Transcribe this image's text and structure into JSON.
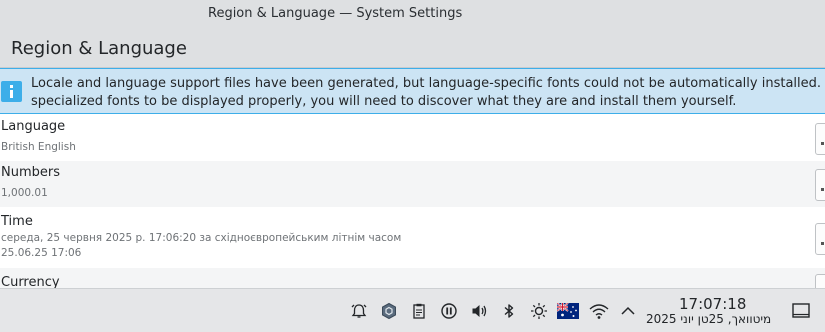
{
  "window": {
    "title": "Region & Language — System Settings"
  },
  "page": {
    "title": "Region & Language"
  },
  "banner": {
    "line1": "Locale and language support files have been generated, but language-specific fonts could not be automatically installed. If your language requires",
    "line2": "specialized fonts to be displayed properly, you will need to discover what they are and install them yourself."
  },
  "settings": [
    {
      "label": "Language",
      "values": [
        "British English"
      ]
    },
    {
      "label": "Numbers",
      "values": [
        "1,000.01"
      ]
    },
    {
      "label": "Time",
      "values": [
        "середа, 25 червня 2025 р. 17:06:20 за східноєвропейським літнім часом",
        "25.06.25 17:06"
      ]
    },
    {
      "label": "Currency",
      "values": []
    }
  ],
  "taskbar": {
    "clock_time": "17:07:18",
    "clock_date": "מיטוואך, 25טן יוני 2025",
    "tray_icons": [
      "alarm-icon",
      "package-icon",
      "clipboard-icon",
      "media-pause-icon",
      "volume-icon",
      "bluetooth-icon",
      "brightness-icon",
      "keyboard-layout-flag-icon",
      "wifi-icon",
      "tray-expand-icon"
    ],
    "colors": {
      "accent": "#3daee9",
      "flag_blue": "#00247d",
      "flag_red": "#cf142b"
    }
  }
}
